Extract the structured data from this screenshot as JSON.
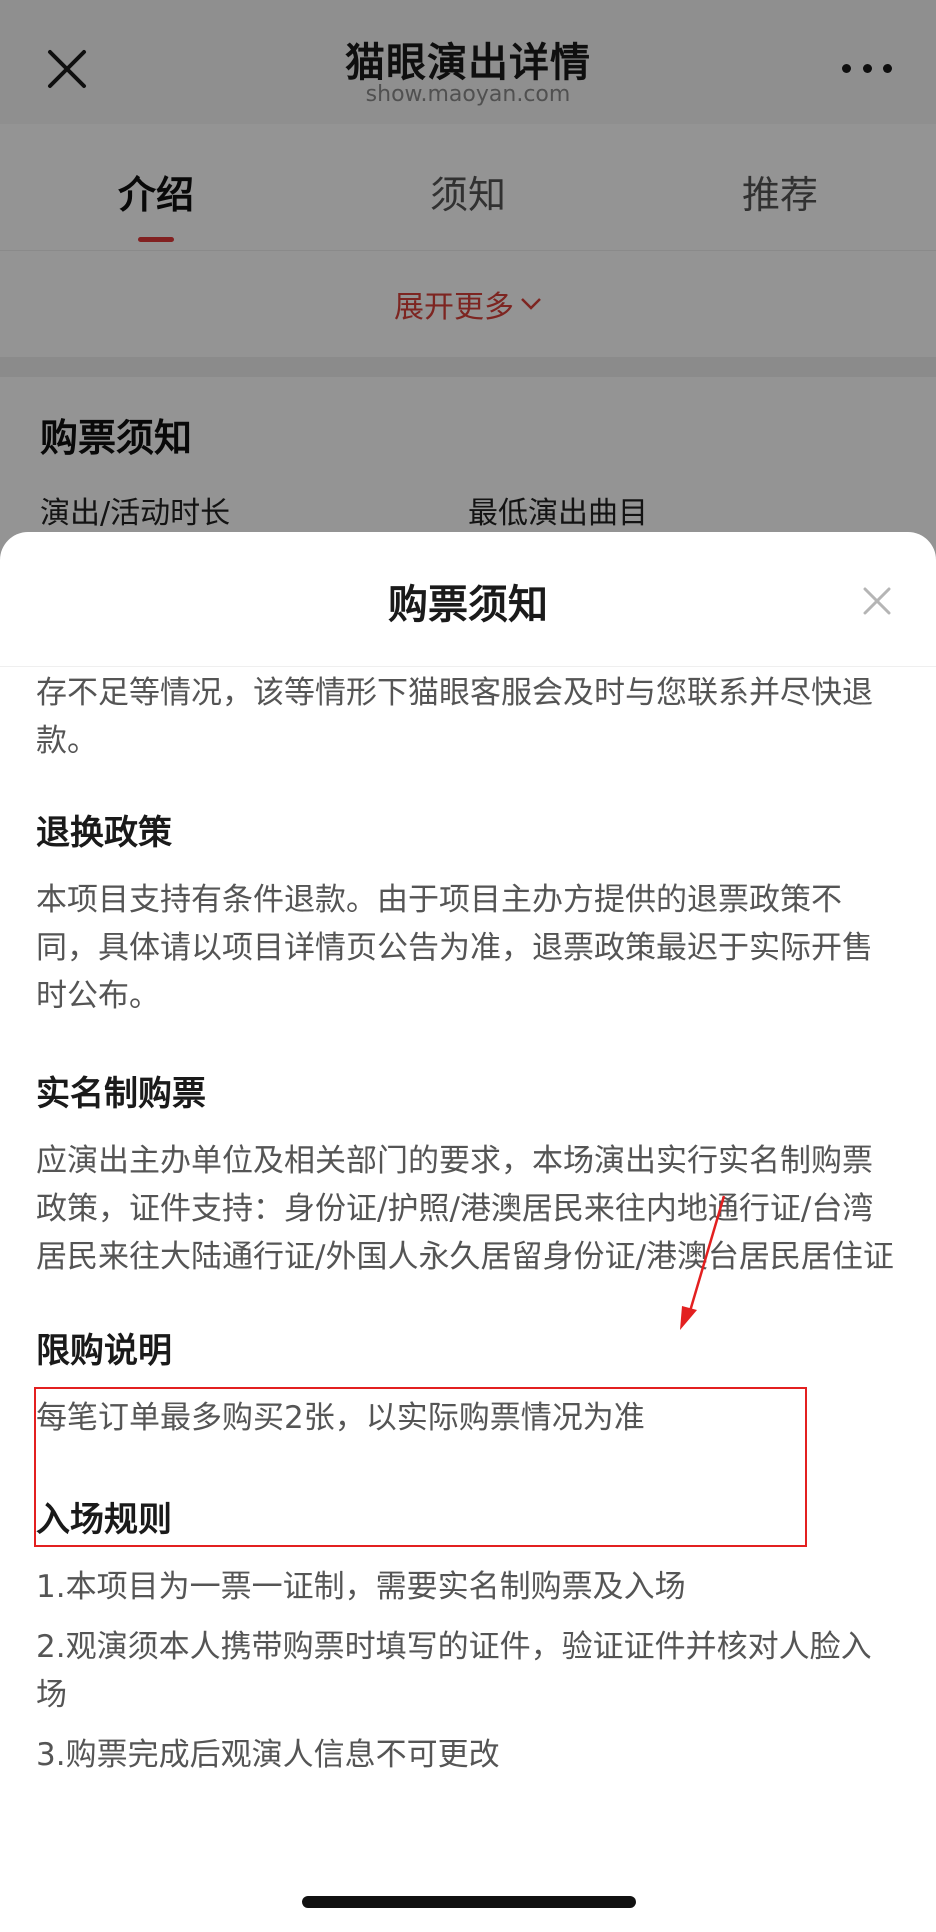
{
  "navbar": {
    "title": "猫眼演出详情",
    "subtitle": "show.maoyan.com",
    "close_icon": "close-icon",
    "more_icon": "more-dots-icon"
  },
  "tabs": [
    {
      "label": "介绍",
      "active": true
    },
    {
      "label": "须知",
      "active": false
    },
    {
      "label": "推荐",
      "active": false
    }
  ],
  "expand_more": "展开更多",
  "under": {
    "section_title": "购票须知",
    "row_left": "演出/活动时长",
    "row_right": "最低演出曲目"
  },
  "sheet": {
    "title": "购票须知",
    "intro_text": "存不足等情况，该等情形下猫眼客服会及时与您联系并尽快退款。",
    "sections": [
      {
        "heading": "退换政策",
        "body": "本项目支持有条件退款。由于项目主办方提供的退票政策不同，具体请以项目详情页公告为准，退票政策最迟于实际开售时公布。"
      },
      {
        "heading": "实名制购票",
        "body": "应演出主办单位及相关部门的要求，本场演出实行实名制购票政策，证件支持：身份证/护照/港澳居民来往内地通行证/台湾居民来往大陆通行证/外国人永久居留身份证/港澳台居民居住证"
      },
      {
        "heading": "限购说明",
        "body": "每笔订单最多购买2张，以实际购票情况为准"
      },
      {
        "heading": "入场规则",
        "lines": [
          "1.本项目为一票一证制，需要实名制购票及入场",
          "2.观演须本人携带购票时填写的证件，验证证件并核对人脸入场",
          "3.购票完成后观演人信息不可更改"
        ]
      }
    ]
  },
  "colors": {
    "accent_red": "#d8413a",
    "annotation_red": "#e32020"
  }
}
